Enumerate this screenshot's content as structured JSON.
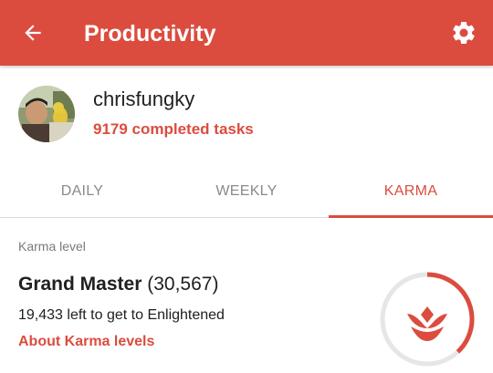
{
  "app": {
    "title": "Productivity"
  },
  "colors": {
    "accent": "#db4c3f",
    "toolbar_text": "#ffffff",
    "muted": "#8a8a8a",
    "divider": "#dcdcdc"
  },
  "icons": {
    "back": "back-arrow-icon",
    "settings": "gear-icon",
    "karma": "karma-lotus-icon"
  },
  "profile": {
    "username": "chrisfungky",
    "completed_tasks": "9179 completed tasks"
  },
  "tabs": [
    {
      "label": "DAILY",
      "active": false
    },
    {
      "label": "WEEKLY",
      "active": false
    },
    {
      "label": "KARMA",
      "active": true
    }
  ],
  "karma": {
    "section_label": "Karma level",
    "level_name": "Grand Master",
    "points": "(30,567)",
    "remaining_text": "19,433 left to get to Enlightened",
    "about_link": "About Karma levels",
    "progress_fraction": 0.38
  }
}
